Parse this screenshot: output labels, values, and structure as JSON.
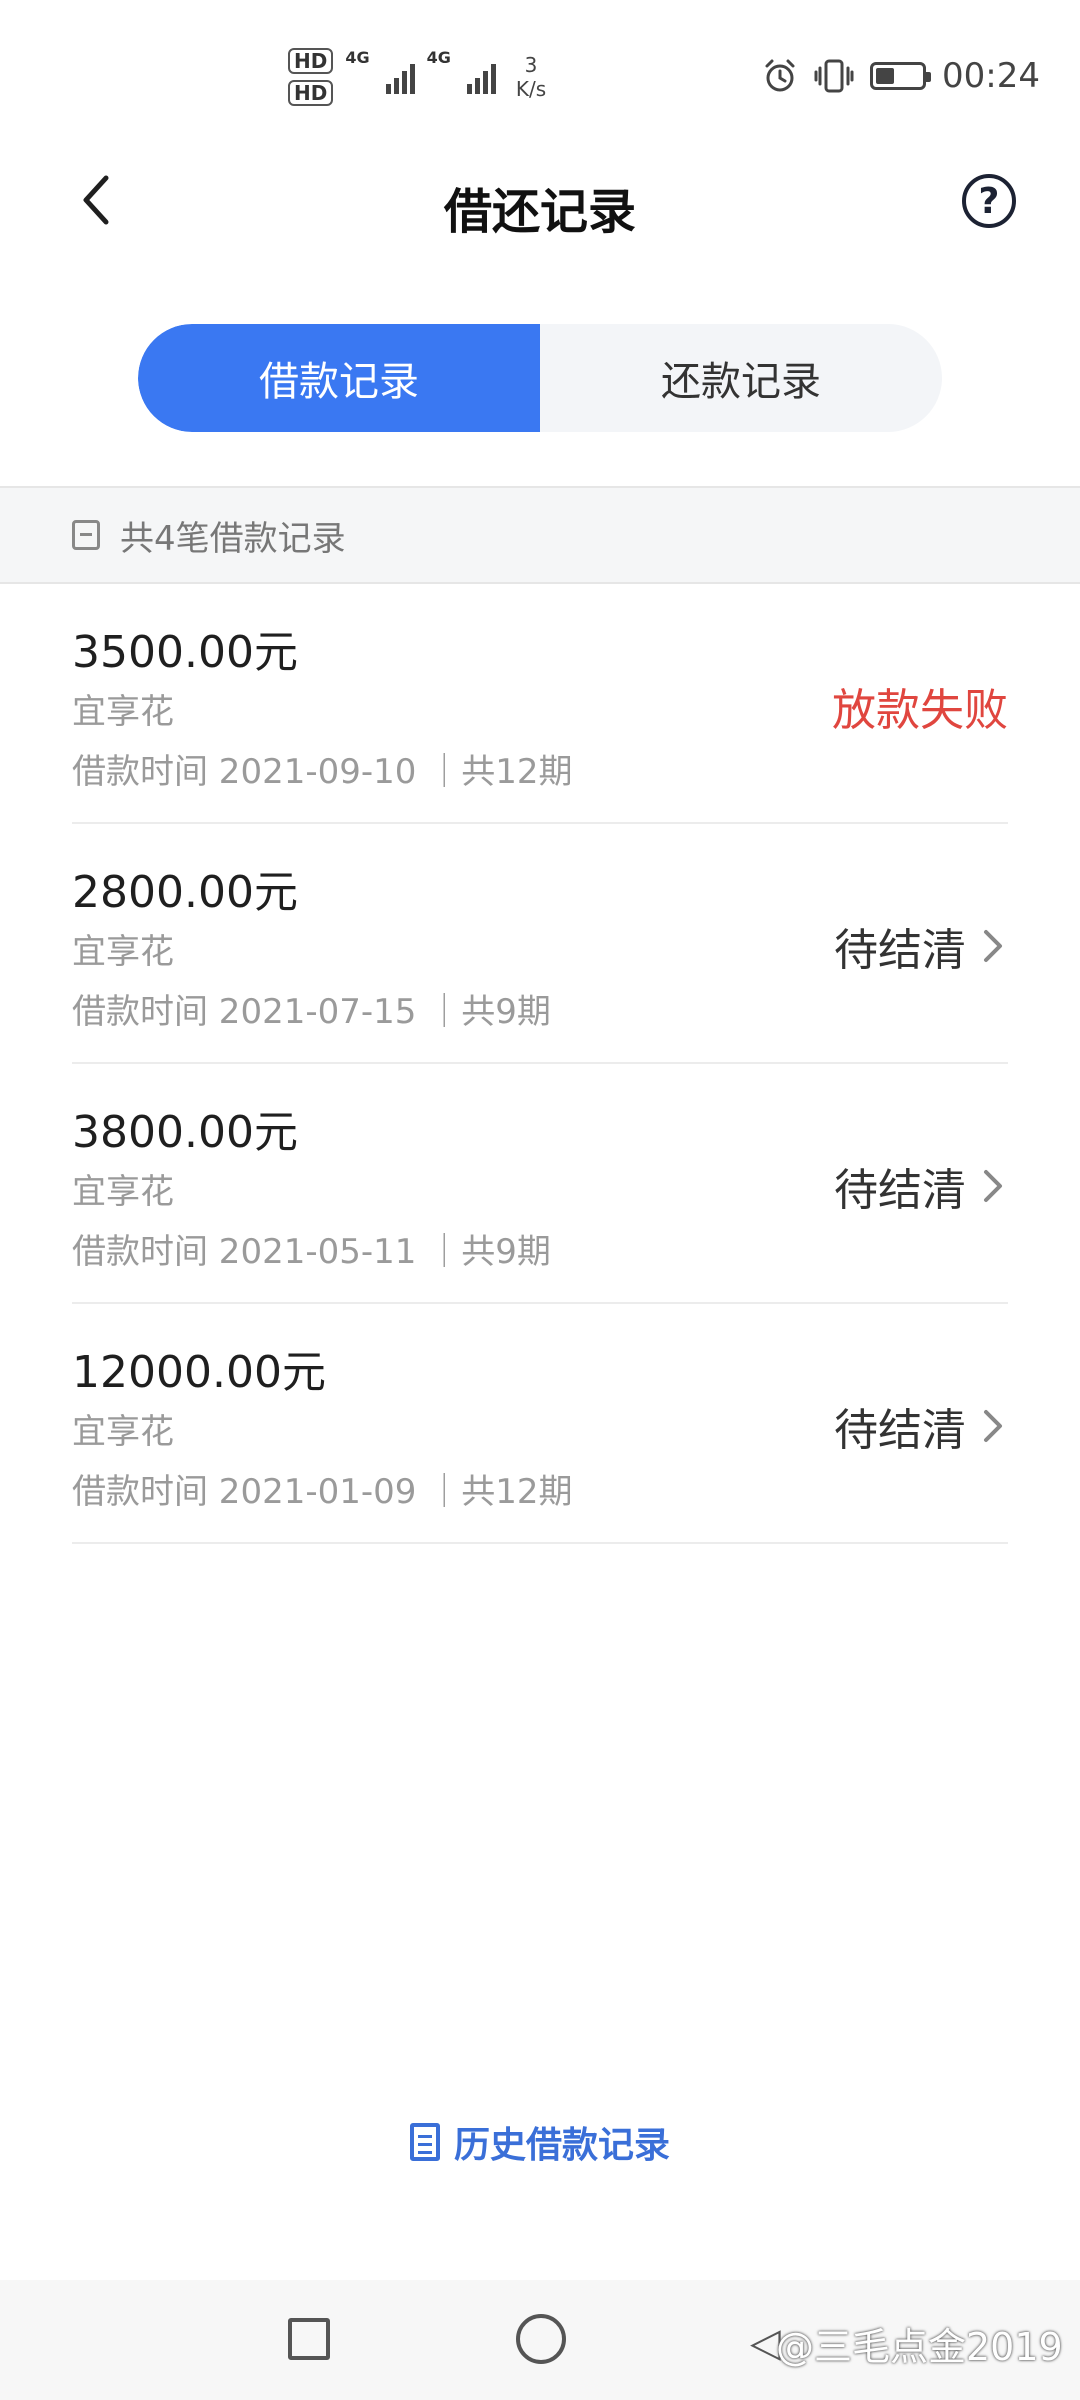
{
  "status_bar": {
    "hd1": "HD",
    "hd2": "HD",
    "net1": "4G",
    "net2": "4G",
    "speed_value": "3",
    "speed_unit": "K/s",
    "time": "00:24"
  },
  "nav": {
    "title": "借还记录"
  },
  "tabs": [
    {
      "label": "借款记录",
      "active": true
    },
    {
      "label": "还款记录",
      "active": false
    }
  ],
  "summary": {
    "text": "共4笔借款记录"
  },
  "records": [
    {
      "amount": "3500.00元",
      "product": "宜享花",
      "meta": "借款时间 2021-09-10 ｜共12期",
      "status": "放款失败",
      "status_color": "#e0463f",
      "has_chevron": false
    },
    {
      "amount": "2800.00元",
      "product": "宜享花",
      "meta": "借款时间 2021-07-15 ｜共9期",
      "status": "待结清",
      "status_color": "#333333",
      "has_chevron": true
    },
    {
      "amount": "3800.00元",
      "product": "宜享花",
      "meta": "借款时间 2021-05-11 ｜共9期",
      "status": "待结清",
      "status_color": "#333333",
      "has_chevron": true
    },
    {
      "amount": "12000.00元",
      "product": "宜享花",
      "meta": "借款时间 2021-01-09 ｜共12期",
      "status": "待结清",
      "status_color": "#333333",
      "has_chevron": true
    }
  ],
  "history_link": {
    "label": "历史借款记录"
  },
  "watermark": {
    "text": "@三毛点金2019"
  },
  "colors": {
    "accent": "#3a78f2",
    "link": "#3a6fd8",
    "fail": "#e0463f"
  }
}
